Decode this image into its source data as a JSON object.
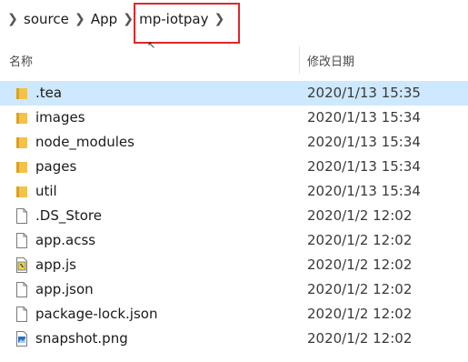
{
  "breadcrumb": {
    "items": [
      "source",
      "App",
      "mp-iotpay"
    ]
  },
  "columns": {
    "name": "名称",
    "date_modified": "修改日期"
  },
  "files": [
    {
      "name": ".tea",
      "date": "2020/1/13 15:35",
      "icon": "folder-icon",
      "selected": true
    },
    {
      "name": "images",
      "date": "2020/1/13 15:34",
      "icon": "folder-icon"
    },
    {
      "name": "node_modules",
      "date": "2020/1/13 15:34",
      "icon": "folder-icon"
    },
    {
      "name": "pages",
      "date": "2020/1/13 15:34",
      "icon": "folder-icon"
    },
    {
      "name": "util",
      "date": "2020/1/13 15:34",
      "icon": "folder-icon"
    },
    {
      "name": ".DS_Store",
      "date": "2020/1/2 12:02",
      "icon": "file-icon"
    },
    {
      "name": "app.acss",
      "date": "2020/1/2 12:02",
      "icon": "file-icon"
    },
    {
      "name": "app.js",
      "date": "2020/1/2 12:02",
      "icon": "js-file-icon"
    },
    {
      "name": "app.json",
      "date": "2020/1/2 12:02",
      "icon": "file-icon"
    },
    {
      "name": "package-lock.json",
      "date": "2020/1/2 12:02",
      "icon": "file-icon"
    },
    {
      "name": "snapshot.png",
      "date": "2020/1/2 12:02",
      "icon": "image-file-icon"
    }
  ],
  "colors": {
    "highlight_box": "#e0262a",
    "selected_row": "#cde8ff",
    "folder": "#f3c24a"
  }
}
